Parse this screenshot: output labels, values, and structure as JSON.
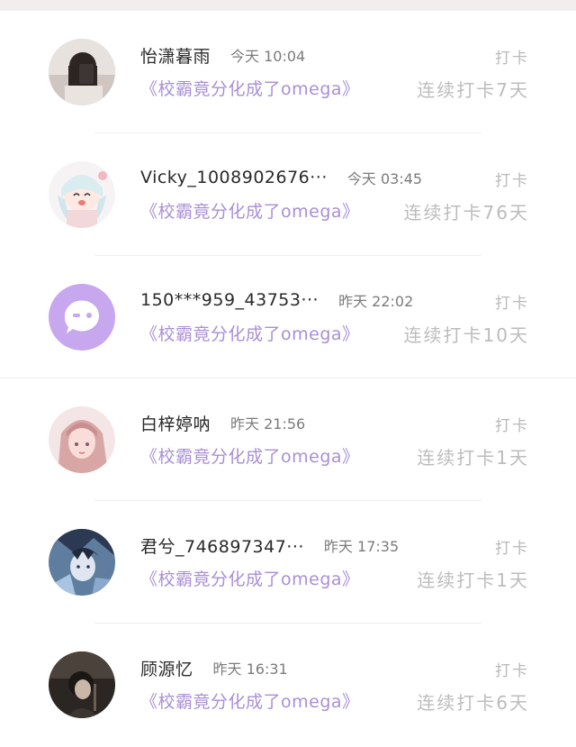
{
  "feed": {
    "items": [
      {
        "user": "怡潇暮雨",
        "time": "今天 10:04",
        "book": "《校霸竟分化成了omega》",
        "action": "打卡",
        "streak": "连续打卡7天",
        "avatar": "photo-avatar"
      },
      {
        "user": "Vicky_1008902676···",
        "time": "今天 03:45",
        "book": "《校霸竟分化成了omega》",
        "action": "打卡",
        "streak": "连续打卡76天",
        "avatar": "anime-avatar"
      },
      {
        "user": "150***959_43753···",
        "time": "昨天 22:02",
        "book": "《校霸竟分化成了omega》",
        "action": "打卡",
        "streak": "连续打卡10天",
        "avatar": "default-avatar"
      },
      {
        "user": "白梓婷呐",
        "time": "昨天 21:56",
        "book": "《校霸竟分化成了omega》",
        "action": "打卡",
        "streak": "连续打卡1天",
        "avatar": "anime-girl-avatar"
      },
      {
        "user": "君兮_746897347···",
        "time": "昨天 17:35",
        "book": "《校霸竟分化成了omega》",
        "action": "打卡",
        "streak": "连续打卡1天",
        "avatar": "anime-boy-avatar"
      },
      {
        "user": "顾源忆",
        "time": "昨天 16:31",
        "book": "《校霸竟分化成了omega》",
        "action": "打卡",
        "streak": "连续打卡6天",
        "avatar": "photo-avatar-dark"
      }
    ]
  }
}
